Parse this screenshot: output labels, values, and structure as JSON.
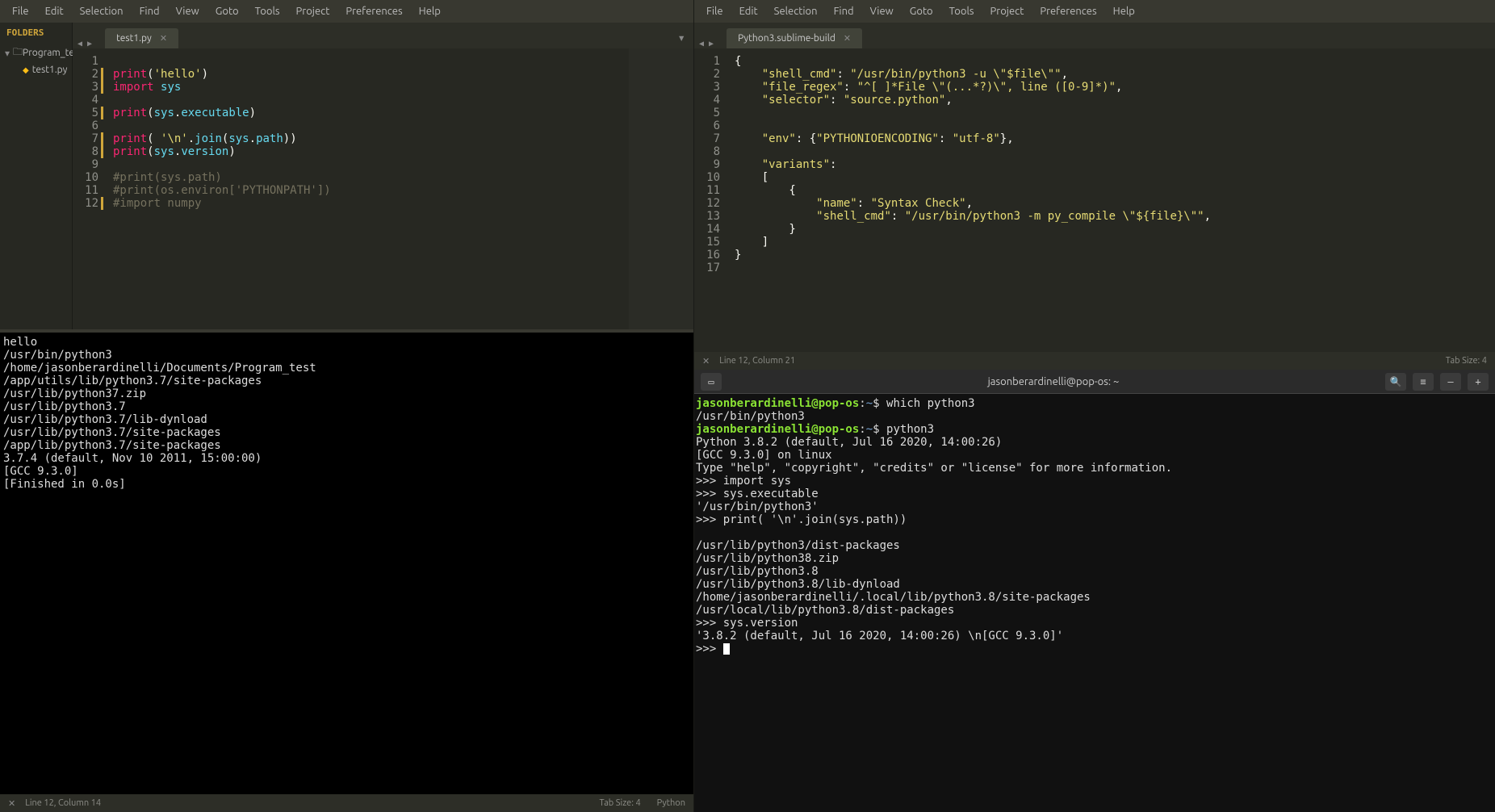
{
  "menu": [
    "File",
    "Edit",
    "Selection",
    "Find",
    "View",
    "Goto",
    "Tools",
    "Project",
    "Preferences",
    "Help"
  ],
  "left": {
    "sidebar": {
      "header": "FOLDERS",
      "folder": "Program_tes",
      "file": "test1.py"
    },
    "tab": "test1.py",
    "code_lines": [
      "",
      "print('hello')",
      "import sys",
      "",
      "print(sys.executable)",
      "",
      "print( '\\n'.join(sys.path))",
      "print(sys.version)",
      "",
      "#print(sys.path)",
      "#print(os.environ['PYTHONPATH'])",
      "#import numpy"
    ],
    "output": "hello\n/usr/bin/python3\n/home/jasonberardinelli/Documents/Program_test\n/app/utils/lib/python3.7/site-packages\n/usr/lib/python37.zip\n/usr/lib/python3.7\n/usr/lib/python3.7/lib-dynload\n/usr/lib/python3.7/site-packages\n/app/lib/python3.7/site-packages\n3.7.4 (default, Nov 10 2011, 15:00:00)\n[GCC 9.3.0]\n[Finished in 0.0s]",
    "status": {
      "pos": "Line 12, Column 14",
      "tab_size": "Tab Size: 4",
      "lang": "Python"
    }
  },
  "right": {
    "tab": "Python3.sublime-build",
    "code_lines": [
      "{",
      "    \"shell_cmd\": \"/usr/bin/python3 -u \\\"$file\\\"\",",
      "    \"file_regex\": \"^[ ]*File \\\"(...*?)\\\", line ([0-9]*)\",",
      "    \"selector\": \"source.python\",",
      "",
      "",
      "    \"env\": {\"PYTHONIOENCODING\": \"utf-8\"},",
      "",
      "    \"variants\":",
      "    [",
      "        {",
      "            \"name\": \"Syntax Check\",",
      "            \"shell_cmd\": \"/usr/bin/python3 -m py_compile \\\"${file}\\\"\",",
      "        }",
      "    ]",
      "}",
      ""
    ],
    "status": {
      "pos": "Line 12, Column 21",
      "tab_size": "Tab Size: 4"
    }
  },
  "terminal": {
    "title": "jasonberardinelli@pop-os: ~",
    "prompt_user": "jasonberardinelli@pop-os",
    "prompt_path": "~",
    "lines": [
      {
        "prompt": true,
        "cmd": "which python3"
      },
      {
        "out": "/usr/bin/python3"
      },
      {
        "prompt": true,
        "cmd": "python3"
      },
      {
        "out": "Python 3.8.2 (default, Jul 16 2020, 14:00:26)"
      },
      {
        "out": "[GCC 9.3.0] on linux"
      },
      {
        "out": "Type \"help\", \"copyright\", \"credits\" or \"license\" for more information."
      },
      {
        "out": ">>> import sys"
      },
      {
        "out": ">>> sys.executable"
      },
      {
        "out": "'/usr/bin/python3'"
      },
      {
        "out": ">>> print( '\\n'.join(sys.path))"
      },
      {
        "out": ""
      },
      {
        "out": "/usr/lib/python3/dist-packages"
      },
      {
        "out": "/usr/lib/python38.zip"
      },
      {
        "out": "/usr/lib/python3.8"
      },
      {
        "out": "/usr/lib/python3.8/lib-dynload"
      },
      {
        "out": "/home/jasonberardinelli/.local/lib/python3.8/site-packages"
      },
      {
        "out": "/usr/local/lib/python3.8/dist-packages"
      },
      {
        "out": ">>> sys.version"
      },
      {
        "out": "'3.8.2 (default, Jul 16 2020, 14:00:26) \\n[GCC 9.3.0]'"
      },
      {
        "out": ">>> ",
        "cursor": true
      }
    ]
  }
}
